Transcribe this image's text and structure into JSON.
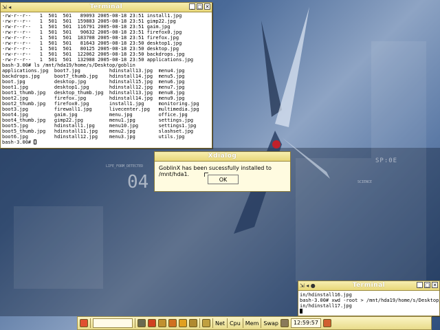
{
  "colors": {
    "titlebar": "#e8d77a",
    "dialog_bg": "#fffbe0",
    "desktop": "#4a6a98"
  },
  "wallpaper": {
    "text_a": "SP:0E",
    "text_b": "04",
    "text_c": "SCIENCE",
    "text_d": "LIFE_FORM_DETECTED"
  },
  "terminal_top": {
    "title": "Terminal",
    "lines": [
      "-rw-r--r--   1  501  501   89093 2005-08-18 23:51 install1.jpg",
      "-rw-r--r--   1  501  501  159883 2005-08-18 23:51 gimp22.jpg",
      "-rw-r--r--   1  501  501  116791 2005-08-18 23:51 gaim.jpg",
      "-rw-r--r--   1  501  501   90632 2005-08-18 23:51 firefox0.jpg",
      "-rw-r--r--   1  501  501  183708 2005-08-18 23:51 firefox.jpg",
      "-rw-r--r--   1  501  501   81643 2005-08-18 23:50 desktop1.jpg",
      "-rw-r--r--   1  501  501   80125 2005-08-18 23:50 desktop.jpg",
      "-rw-r--r--   1  501  501  122062 2005-08-18 23:50 backdrops.jpg",
      "-rw-r--r--   1  501  501  132988 2005-08-18 23:50 applications.jpg",
      "bash-3.00# ls /mnt/hda19/home/s/Desktop/goblin",
      "applications.jpg  boot7.jpg          hdinstall13.jpg  menu4.jpg",
      "backdrops.jpg     boot7_thumb.jpg    hdinstall14.jpg  menu5.jpg",
      "boot.jpg          desktop.jpg        hdinstall15.jpg  menu6.jpg",
      "boot1.jpg         desktop1.jpg       hdinstall12.jpg  menu7.jpg",
      "boot1_thumb.jpg   desktop_thumb.jpg  hdinstall13.jpg  menu8.jpg",
      "boot2.jpg         firefox.jpg        hdinstall14.jpg  menu9.jpg",
      "boot2_thumb.jpg   firefox0.jpg       install1.jpg     monitoring.jpg",
      "boot3.jpg         firewall1.jpg      livecenter.jpg   multimedia.jpg",
      "boot4.jpg         gaim.jpg           menu.jpg         office.jpg",
      "boot4_thumb.jpg   gimp22.jpg         menu1.jpg        settings.jpg",
      "boot5.jpg         hdinstall1.jpg     menu10.jpg       settings1.jpg",
      "boot5_thumb.jpg   hdinstall11.jpg    menu2.jpg        slashset.jpg",
      "boot6.jpg         hdinstall12.jpg    menu3.jpg        utils.jpg"
    ],
    "prompt": "bash-3.00# "
  },
  "dialog": {
    "title": "Xdialog",
    "message": "GoblinX has been sucessfully installed to /mnt/hda1.",
    "ok_label": "OK"
  },
  "terminal_bottom": {
    "title": "Terminal",
    "lines": [
      "in/hdinstall16.jpg",
      "bash-3.00# xwd -root > /mnt/hda19/home/s/Desktop/gobl",
      "in/hdinstall17.jpg"
    ]
  },
  "taskbar": {
    "net_label": "Net",
    "cpu_label": "Cpu",
    "mem_label": "Mem",
    "swap_label": "Swap",
    "clock": "12:59:57"
  }
}
